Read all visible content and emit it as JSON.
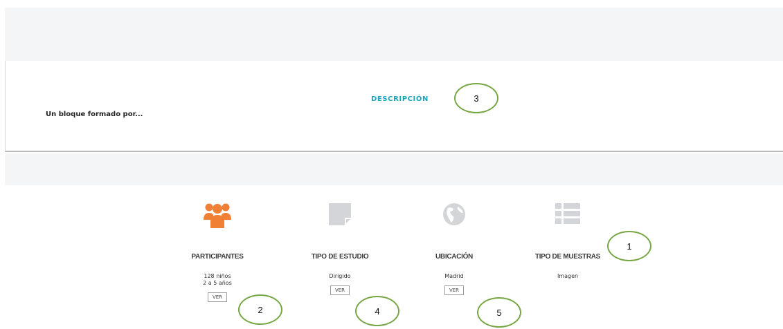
{
  "card": {
    "text": "Un bloque formado por...",
    "tab_label": "DESCRIPCIÓN"
  },
  "stats": [
    {
      "icon": "users-icon",
      "title": "PARTICIPANTES",
      "value_lines": [
        "128 niños",
        "2 a 5 años"
      ],
      "button": "VER"
    },
    {
      "icon": "note-icon",
      "title": "TIPO DE ESTUDIO",
      "value_lines": [
        "Dirigido"
      ],
      "button": "VER"
    },
    {
      "icon": "globe-icon",
      "title": "UBICACIÓN",
      "value_lines": [
        "Madrid"
      ],
      "button": "VER"
    },
    {
      "icon": "list-icon",
      "title": "TIPO DE MUESTRAS",
      "value_lines": [
        "Imagen"
      ]
    }
  ],
  "markers": [
    "1",
    "2",
    "3",
    "4",
    "5"
  ],
  "colors": {
    "accent_orange": "#f08036",
    "accent_teal": "#1fa3b8",
    "icon_gray": "#d3d5d8",
    "marker_green": "#77a644",
    "band_bg": "#f3f5f7"
  }
}
